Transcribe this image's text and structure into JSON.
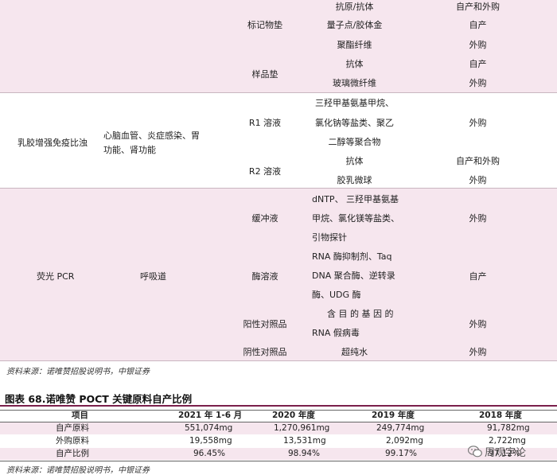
{
  "rows": {
    "marker_pad": {
      "label": "标记物垫",
      "items": [
        {
          "material": "抗原/抗体",
          "source": "自产和外购"
        },
        {
          "material": "量子点/胶体金",
          "source": "自产"
        },
        {
          "material": "聚酯纤维",
          "source": "外购"
        }
      ]
    },
    "sample_pad": {
      "label": "样品垫",
      "items": [
        {
          "material": "抗体",
          "source": "自产"
        },
        {
          "material": "玻璃微纤维",
          "source": "外购"
        }
      ]
    },
    "latex": {
      "method": "乳胶增强免疫比浊",
      "area_line1": "心脑血管、炎症感染、胃",
      "area_line2": "功能、肾功能",
      "r1": {
        "label": "R1 溶液",
        "material_lines": [
          "三羟甲基氨基甲烷、",
          "氯化钠等盐类、聚乙",
          "二醇等聚合物"
        ],
        "source": "外购"
      },
      "r2": {
        "label": "R2 溶液",
        "items": [
          {
            "material": "抗体",
            "source": "自产和外购"
          },
          {
            "material": "胶乳微球",
            "source": "外购"
          }
        ]
      }
    },
    "pcr": {
      "method": "荧光 PCR",
      "area": "呼吸道",
      "buffer": {
        "label": "缓冲液",
        "material_lines": [
          "dNTP、 三羟甲基氨基",
          "甲烷、氯化镁等盐类、",
          "引物探针"
        ],
        "source": "外购"
      },
      "enzyme": {
        "label": "酶溶液",
        "material_lines": [
          "RNA  酶抑制剂、Taq",
          "DNA  聚合酶、逆转录",
          "酶、UDG 酶"
        ],
        "source": "自产"
      },
      "positive": {
        "label": "阳性对照品",
        "material_lines": [
          "含 目 的 基 因 的",
          "RNA 假病毒"
        ],
        "source": "外购"
      },
      "negative": {
        "label": "阴性对照品",
        "material": "超纯水",
        "source": "外购"
      }
    }
  },
  "source_note_1": "资料来源：诺唯赞招股说明书，中银证券",
  "figure_title": "图表 68.诺唯赞 POCT 关键原料自产比例",
  "table2": {
    "headers": [
      "项目",
      "2021 年 1-6 月",
      "2020 年度",
      "2019 年度",
      "2018 年度"
    ],
    "rows": [
      [
        "自产原料",
        "551,074mg",
        "1,270,961mg",
        "249,774mg",
        "91,782mg"
      ],
      [
        "外购原料",
        "19,558mg",
        "13,531mg",
        "2,092mg",
        "2,722mg"
      ],
      [
        "自产比例",
        "96.45%",
        "98.94%",
        "99.17%",
        "97.12%"
      ]
    ]
  },
  "source_note_2": "资料来源：诺唯赞招股说明书，中银证券",
  "watermark": "周观宇论"
}
